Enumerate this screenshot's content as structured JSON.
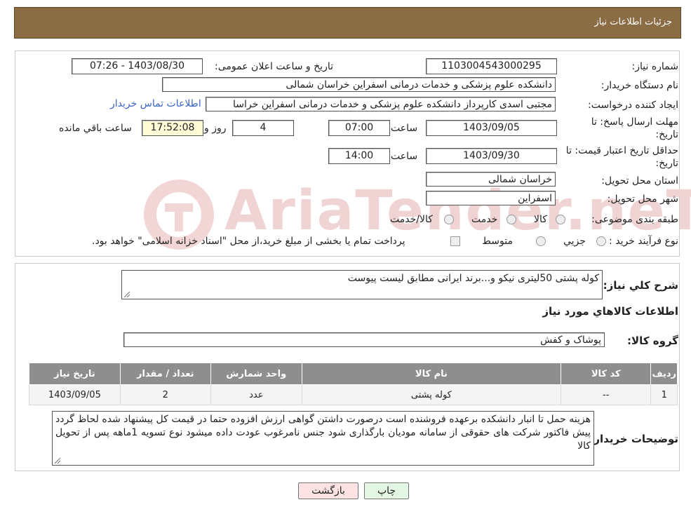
{
  "header": {
    "title": "جزئیات اطلاعات نیاز"
  },
  "fields": {
    "need_number_label": "شماره نیاز:",
    "need_number": "1103004543000295",
    "announce_label": "تاریخ و ساعت اعلان عمومی:",
    "announce_value": "1403/08/30 - 07:26",
    "buyer_org_label": "نام دستگاه خریدار:",
    "buyer_org": "دانشکده علوم پزشکی و خدمات درمانی اسفراین خراسان شمالی",
    "creator_label": "ایجاد کننده درخواست:",
    "creator": "مجتبی اسدی کارپرداز  دانشکده علوم پزشکی و خدمات درمانی اسفراین خراسا",
    "contact_link": "اطلاعات تماس خریدار",
    "deadline_label_1": "مهلت ارسال پاسخ: تا",
    "deadline_label_2": "تاریخ:",
    "deadline_date": "1403/09/05",
    "time_word": "ساعت",
    "deadline_time": "07:00",
    "days": "4",
    "days_word": "روز و",
    "remaining_time": "17:52:08",
    "remaining_word": "ساعت باقي مانده",
    "validity_label_1": "حداقل تاریخ اعتبار قیمت: تا",
    "validity_label_2": "تاریخ:",
    "validity_date": "1403/09/30",
    "validity_time": "14:00",
    "province_label": "استان محل تحویل:",
    "province": "خراسان شمالی",
    "city_label": "شهر محل تحویل:",
    "city": "اسفراین",
    "category_label": "طبقه بندی موضوعی:",
    "category_options": [
      "کالا",
      "خدمت",
      "کالا/خدمت"
    ],
    "process_label": "نوع فرآیند خرید :",
    "process_options": [
      "جزیي",
      "متوسط"
    ],
    "process_note": "پرداخت تمام یا بخشی از مبلغ خرید،از محل \"اسناد خزانه اسلامی\" خواهد بود."
  },
  "summary": {
    "label": "شرح کلي نياز:",
    "text": "کوله پشتی 50لیتری نیکو و...برند ایرانی مطابق لیست پیوست"
  },
  "goods": {
    "title": "اطلاعات کالاهاي مورد نياز",
    "group_label": "گروه کالا:",
    "group_value": "پوشاک و کفش",
    "columns": [
      "ردیف",
      "کد کالا",
      "نام کالا",
      "واحد شمارش",
      "تعداد / مقدار",
      "تاریخ نیاز"
    ],
    "rows": [
      [
        "1",
        "--",
        "کوله پشتی",
        "عدد",
        "2",
        "1403/09/05"
      ]
    ]
  },
  "buyer_notes": {
    "label": "توضیحات خریدار:",
    "text": "هزینه حمل تا انبار دانشکده برعهده فروشنده است درصورت داشتن گواهی ارزش افزوده حتما در قیمت کل پیشنهاد شده لحاظ گردد پیش فاکتور شرکت های حقوقی از سامانه مودیان بارگذاری شود جنس نامرغوب عودت داده میشود نوع تسویه 1ماهه پس از تحویل کالا"
  },
  "buttons": {
    "print": "چاپ",
    "back": "بازگشت"
  },
  "watermark": "AriaTender.neT",
  "colors": {
    "header_bg": "#8b6d45",
    "table_header_bg": "#8e8e8e",
    "link": "#3b64c4",
    "back_button_bg": "#fde3e3",
    "print_button_bg": "#e3f5e3"
  }
}
